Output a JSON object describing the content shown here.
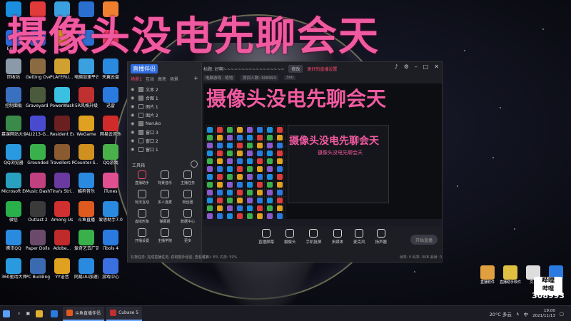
{
  "overlay_title": "摄像头没电先聊会天",
  "preview": {
    "title_large": "摄像头没电先聊会天",
    "title_medium": "摄像头没电先聊会天",
    "title_small": "摄像头没电先聊会天"
  },
  "desktop_icons": [
    {
      "label": "",
      "color": "#1a8fe0"
    },
    {
      "label": "",
      "color": "#e03a3a"
    },
    {
      "label": "",
      "color": "#3aa0e0"
    },
    {
      "label": "",
      "color": "#2a6fd0"
    },
    {
      "label": "",
      "color": "#f08030"
    },
    {
      "label": "Expl...",
      "color": "#2d6cdf"
    },
    {
      "label": "",
      "color": "#2d6cdf"
    },
    {
      "label": "",
      "color": "#e0a020"
    },
    {
      "label": "",
      "color": "#2a6fd0"
    },
    {
      "label": "",
      "color": "#f04060"
    },
    {
      "label": "回收站",
      "color": "#8a9aa8"
    },
    {
      "label": "Getting Over It wi...",
      "color": "#8a6a40"
    },
    {
      "label": "PLAYERU... BATTLEGR...",
      "color": "#d0a030"
    },
    {
      "label": "电脑加速平台",
      "color": "#3aa0e0"
    },
    {
      "label": "天翼云盘",
      "color": "#2a8ae0"
    },
    {
      "label": "控制面板",
      "color": "#3a70c0"
    },
    {
      "label": "Graveyard Keeper",
      "color": "#4a5a3a"
    },
    {
      "label": "PowerWash Simulator",
      "color": "#3ac0e0"
    },
    {
      "label": "5R风格升级",
      "color": "#c03030"
    },
    {
      "label": "迅雷",
      "color": "#2a7ae0"
    },
    {
      "label": "慕课网站大全",
      "color": "#3a8a4a"
    },
    {
      "label": "ALI213-G...",
      "color": "#4a4ad0"
    },
    {
      "label": "Resident Evil 7 Bi...",
      "color": "#6a2020"
    },
    {
      "label": "WeGame",
      "color": "#e0a020"
    },
    {
      "label": "网易云音乐",
      "color": "#d02a2a"
    },
    {
      "label": "QQ浏览器",
      "color": "#2a9ae0"
    },
    {
      "label": "Grounded",
      "color": "#3ab04a"
    },
    {
      "label": "Travellers Rest",
      "color": "#8a5a30"
    },
    {
      "label": "Counter-S... Global Off...",
      "color": "#d09020"
    },
    {
      "label": "QQ游戏",
      "color": "#4ab04a"
    },
    {
      "label": "Microsoft Edge",
      "color": "#2aa0c0"
    },
    {
      "label": "Music Dash",
      "color": "#c04080"
    },
    {
      "label": "Tina's Stri...",
      "color": "#6a3aa0"
    },
    {
      "label": "酷狗音乐",
      "color": "#2a8ae0"
    },
    {
      "label": "iTunes",
      "color": "#e05090"
    },
    {
      "label": "微信",
      "color": "#2ab04a"
    },
    {
      "label": "Outlast 2",
      "color": "#3a3a3a"
    },
    {
      "label": "Among Us",
      "color": "#d03030"
    },
    {
      "label": "斗鱼直播",
      "color": "#e05a20"
    },
    {
      "label": "爱思助手7.0",
      "color": "#2a8ae0"
    },
    {
      "label": "腾讯QQ",
      "color": "#2a8ae0"
    },
    {
      "label": "Paper Dolls Original",
      "color": "#6a4a6a"
    },
    {
      "label": "Adobe...",
      "color": "#c02a2a"
    },
    {
      "label": "爱奇艺去广告",
      "color": "#3ab04a"
    },
    {
      "label": "iTools 4",
      "color": "#2a7ae0"
    },
    {
      "label": "360驱动大师",
      "color": "#2a9ae0"
    },
    {
      "label": "PC Building Simulator",
      "color": "#3a6ab0"
    },
    {
      "label": "YY语音",
      "color": "#e0a020"
    },
    {
      "label": "网易UU加速器",
      "color": "#2a8ae0"
    },
    {
      "label": "游戏中心",
      "color": "#3a70e0"
    }
  ],
  "app_window": {
    "logo": "直播伴侣",
    "scene_tabs": [
      "场景1",
      "互动",
      "高亮",
      "场景"
    ],
    "sources": [
      {
        "name": "文本 2",
        "on": true
      },
      {
        "name": "合图 1",
        "on": true
      },
      {
        "name": "图片 1",
        "on": false
      },
      {
        "name": "图片 2",
        "on": false
      },
      {
        "name": "Naruko",
        "on": true
      },
      {
        "name": "窗口 3",
        "on": true
      },
      {
        "name": "窗口 2",
        "on": false
      },
      {
        "name": "窗口 1",
        "on": false
      }
    ],
    "tools_label": "工具箱",
    "tools": [
      {
        "label": "直播助手",
        "hot": true
      },
      {
        "label": "背景音乐",
        "hot": false
      },
      {
        "label": "主播任务",
        "hot": false
      },
      {
        "label": "玩法互动",
        "hot": false
      },
      {
        "label": "多人连麦",
        "hot": false
      },
      {
        "label": "粉丝团",
        "hot": false
      },
      {
        "label": "虚拟形象",
        "hot": false
      },
      {
        "label": "弹幕姬",
        "hot": false
      },
      {
        "label": "数据中心",
        "hot": false
      },
      {
        "label": "开播设置",
        "hot": false
      },
      {
        "label": "主播学院",
        "hot": false
      },
      {
        "label": "更多",
        "hot": false
      }
    ],
    "status_text": "礼物任务: 完成直播任务, 获取额外经验, 查看更多",
    "top_title": "标题: 好啊~~~~~~~~~~~~~~~~~",
    "top_pill": "修改",
    "top_red": "更好的直播设置",
    "controls_info": [
      "电脑游戏 · 绝地",
      "房间人数: 308993",
      "300"
    ],
    "controls": [
      {
        "label": "直播屏幕"
      },
      {
        "label": "摄像头"
      },
      {
        "label": "手机投屏"
      },
      {
        "label": "多媒体"
      },
      {
        "label": "麦克风"
      },
      {
        "label": "扬声器"
      }
    ],
    "go_live": "开始直播",
    "bottom_left": "CPU: 8%  内存: 59%",
    "bottom_right": "帧率: 0  码率: 0KB  丢帧: 0"
  },
  "right_icons": [
    {
      "label": "直播软件",
      "color": "#e0a040"
    },
    {
      "label": "直播助手软件",
      "color": "#e0c040"
    },
    {
      "label": "文...",
      "color": "#ddd"
    },
    {
      "label": "",
      "color": "#2a7ae0"
    }
  ],
  "bilibili": {
    "line1": "哔哩",
    "line2": "哔哩",
    "followers": "308993"
  },
  "taskbar": {
    "apps": [
      {
        "label": "斗鱼直播伴侣",
        "color": "#e05a20"
      },
      {
        "label": "Cubase 5",
        "color": "#c03030"
      }
    ],
    "weather": "20°C 多云",
    "ime": "中",
    "time": "19:00",
    "date": "2021/11/13"
  }
}
